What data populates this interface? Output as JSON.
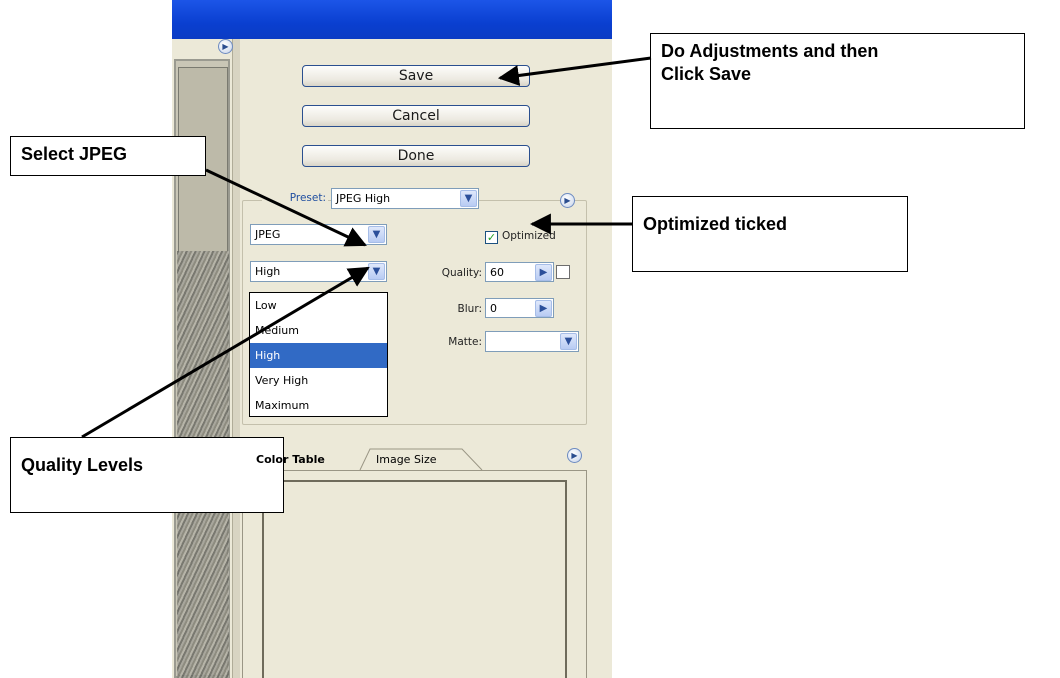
{
  "buttons": {
    "save": "Save",
    "cancel": "Cancel",
    "done": "Done"
  },
  "preset": {
    "label": "Preset:",
    "value": "JPEG High"
  },
  "format": {
    "value": "JPEG"
  },
  "quality_level": {
    "value": "High",
    "options": [
      "Low",
      "Medium",
      "High",
      "Very High",
      "Maximum"
    ],
    "selected_index": 2
  },
  "optimized": {
    "label": "Optimized",
    "checked": true
  },
  "quality": {
    "label": "Quality:",
    "value": "60"
  },
  "blur": {
    "label": "Blur:",
    "value": "0"
  },
  "matte": {
    "label": "Matte:",
    "value": ""
  },
  "tabs": {
    "color_table": "Color Table",
    "image_size": "Image Size"
  },
  "callouts": {
    "save": "Do Adjustments and then Click Save",
    "jpeg": "Select JPEG",
    "optimized": "Optimized ticked",
    "quality": "Quality Levels"
  },
  "icons": {
    "menu": "circle-play-icon",
    "dropdown": "chevron-down-icon",
    "spin": "chevron-right-icon",
    "preview_toggle": "square-icon",
    "checkbox": "checkmark-icon"
  },
  "colors": {
    "titlebar": "#0a3fd0",
    "selection": "#316ac5",
    "panel": "#ece9d8"
  }
}
